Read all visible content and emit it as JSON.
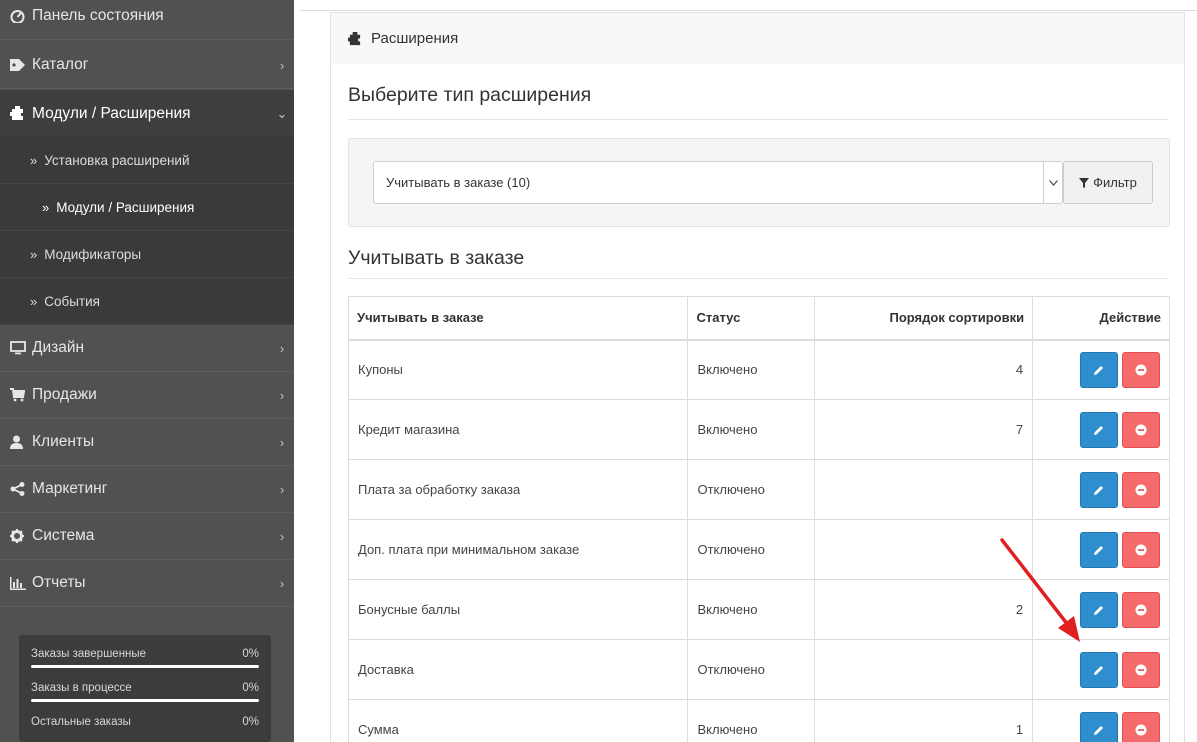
{
  "sidebar": {
    "items": [
      {
        "label": "Панель состояния",
        "icon": "dashboard-icon"
      },
      {
        "label": "Каталог",
        "icon": "tag-icon"
      },
      {
        "label": "Модули / Расширения",
        "icon": "puzzle-icon"
      },
      {
        "label": "Дизайн",
        "icon": "monitor-icon"
      },
      {
        "label": "Продажи",
        "icon": "cart-icon"
      },
      {
        "label": "Клиенты",
        "icon": "user-icon"
      },
      {
        "label": "Маркетинг",
        "icon": "share-icon"
      },
      {
        "label": "Система",
        "icon": "gear-icon"
      },
      {
        "label": "Отчеты",
        "icon": "bar-chart-icon"
      }
    ],
    "submenu": [
      {
        "label": "Установка расширений"
      },
      {
        "label": "Модули / Расширения"
      },
      {
        "label": "Модификаторы"
      },
      {
        "label": "События"
      }
    ],
    "raquo": "»",
    "chevron_right": "›",
    "chevron_down": "⌄"
  },
  "stats": [
    {
      "label": "Заказы завершенные",
      "value": "0%"
    },
    {
      "label": "Заказы в процессе",
      "value": "0%"
    },
    {
      "label": "Остальные заказы",
      "value": "0%"
    }
  ],
  "panel": {
    "title": "Расширения",
    "choose_type": "Выберите тип расширения",
    "select_value": "Учитывать в заказе (10)",
    "filter_button": "Фильтр",
    "section_title": "Учитывать в заказе"
  },
  "table": {
    "headers": [
      "Учитывать в заказе",
      "Статус",
      "Порядок сортировки",
      "Действие"
    ],
    "rows": [
      {
        "name": "Купоны",
        "status": "Включено",
        "sort": "4"
      },
      {
        "name": "Кредит магазина",
        "status": "Включено",
        "sort": "7"
      },
      {
        "name": "Плата за обработку заказа",
        "status": "Отключено",
        "sort": ""
      },
      {
        "name": "Доп. плата при минимальном заказе",
        "status": "Отключено",
        "sort": ""
      },
      {
        "name": "Бонусные баллы",
        "status": "Включено",
        "sort": "2"
      },
      {
        "name": "Доставка",
        "status": "Отключено",
        "sort": ""
      },
      {
        "name": "Сумма",
        "status": "Включено",
        "sort": "1"
      }
    ]
  },
  "colors": {
    "sidebar_bg": "#515151",
    "edit_button": "#2e8ece",
    "uninstall_button": "#f56b6b",
    "annotation_arrow": "#e02020"
  }
}
